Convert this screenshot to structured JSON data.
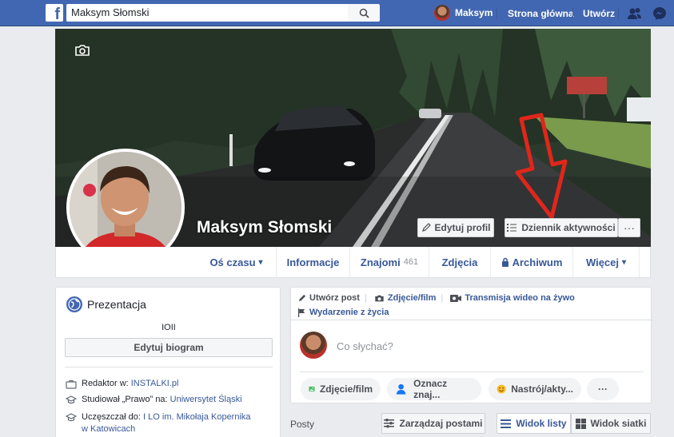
{
  "topbar": {
    "logo": "f",
    "search_value": "Maksym Słomski",
    "user_name": "Maksym",
    "home_label": "Strona główna",
    "create_label": "Utwórz"
  },
  "profile": {
    "name": "Maksym Słomski",
    "edit_profile_label": "Edytuj profil",
    "activity_log_label": "Dziennik aktywności",
    "more_label": "···"
  },
  "tabs": [
    {
      "label": "Oś czasu",
      "caret": "▾"
    },
    {
      "label": "Informacje"
    },
    {
      "label": "Znajomi",
      "count": "461"
    },
    {
      "label": "Zdjęcia"
    },
    {
      "label": "Archiwum"
    },
    {
      "label": "Więcej",
      "caret": "▾"
    }
  ],
  "intro": {
    "title": "Prezentacja",
    "bio": "IOII",
    "edit_bio_label": "Edytuj biogram",
    "rows": [
      {
        "prefix": "Redaktor w: ",
        "link": "INSTALKI.pl"
      },
      {
        "prefix": "Studiował „Prawo” na: ",
        "link": "Uniwersytet Śląski"
      },
      {
        "prefix": "Uczęszczał do: ",
        "link": "I LO im. Mikołaja Kopernika w Katowicach"
      }
    ]
  },
  "composer": {
    "tab_create": "Utwórz post",
    "tab_photo": "Zdjęcie/film",
    "tab_live": "Transmisja wideo na żywo",
    "tab_event": "Wydarzenie z życia",
    "placeholder": "Co słychać?",
    "pill_photo": "Zdjęcie/film",
    "pill_tag": "Oznacz znaj...",
    "pill_feeling": "Nastrój/akty...",
    "pill_more": "···"
  },
  "posts": {
    "label": "Posty",
    "manage_label": "Zarządzaj postami",
    "list_view_label": "Widok listy",
    "grid_view_label": "Widok siatki"
  },
  "colors": {
    "brand_blue": "#4267b2",
    "link_blue": "#385898",
    "annotation_red": "#e0261b"
  }
}
